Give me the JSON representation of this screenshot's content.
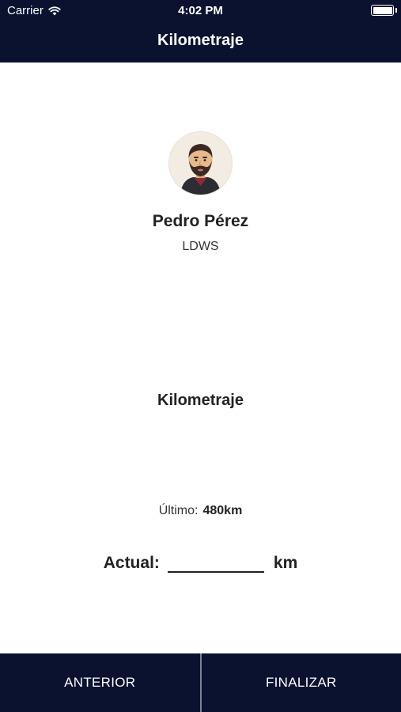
{
  "status_bar": {
    "carrier": "Carrier",
    "time": "4:02 PM",
    "icons": [
      "wifi-icon",
      "battery-icon"
    ]
  },
  "nav": {
    "title": "Kilometraje"
  },
  "user": {
    "name": "Pedro Pérez",
    "code": "LDWS",
    "avatar_icon": "bearded-man-avatar"
  },
  "section": {
    "title": "Kilometraje"
  },
  "mileage": {
    "last_label": "Último:",
    "last_value": "480km",
    "actual_label": "Actual:",
    "actual_value": "",
    "unit": "km"
  },
  "footer": {
    "prev_label": "ANTERIOR",
    "finish_label": "FINALIZAR"
  },
  "colors": {
    "bar_background": "#0a1230",
    "divider": "#7d8294",
    "text": "#222222"
  }
}
